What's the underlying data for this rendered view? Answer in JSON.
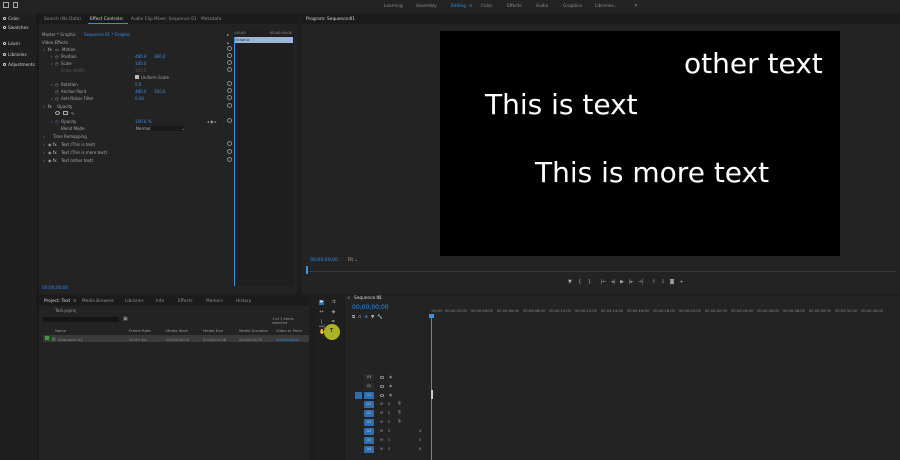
{
  "workspaces": [
    "Learning",
    "Assembly",
    "Editing",
    "Color",
    "Effects",
    "Audio",
    "Graphics",
    "Libraries..."
  ],
  "more_workspaces": "»",
  "left_nav": [
    "Color",
    "Swatches",
    "Learn",
    "Libraries",
    "Adjustments"
  ],
  "source_tabs": [
    "Search (No Data)",
    "Effect Controls",
    "Audio Clip Mixer: Sequence 01",
    "Metadata"
  ],
  "ec": {
    "master": "Master * Graphic",
    "sequence": "Sequence 01 * Graphic",
    "ruler_start": ";00;00",
    "ruler_end": "00;00;04;00",
    "clip": "Graphic",
    "video_effects": "Video Effects",
    "motion": "Motion",
    "position": "Position",
    "position_x": "480.0",
    "position_y": "360.0",
    "scale": "Scale",
    "scale_v": "100.0",
    "scale_width": "Scale Width",
    "scale_width_v": "100.0",
    "uniform": "Uniform Scale",
    "rotation": "Rotation",
    "rotation_v": "0.0",
    "anchor": "Anchor Point",
    "anchor_x": "480.0",
    "anchor_y": "360.0",
    "anti_flicker": "Anti-flicker Filter",
    "anti_flicker_v": "0.00",
    "opacity": "Opacity",
    "opacity_prop": "Opacity",
    "opacity_v": "100.0 %",
    "blend": "Blend Mode",
    "blend_v": "Normal",
    "time_remap": "Time Remapping",
    "text1": "Text (This is text)",
    "text2": "Text (This is more text)",
    "text3": "Text (other text)",
    "timecode": "00;00;00;00"
  },
  "program": {
    "title": "Program: Sequence 01",
    "text_other": "other text",
    "text_main": "This is text",
    "text_more": "This is more text",
    "timecode": "00;00;00;00",
    "fit": "Fit"
  },
  "project_tabs": [
    "Project: Text",
    "Media Browser",
    "Libraries",
    "Info",
    "Effects",
    "Markers",
    "History"
  ],
  "project": {
    "file": "Text.prproj",
    "items_selected": "1 of 1 items selected",
    "columns": [
      "Name",
      "Frame Rate",
      "Media Start",
      "Media End",
      "Media Duration",
      "Video In Point"
    ],
    "row": [
      "Sequence 01",
      "29.97 fps",
      "00;00;00;00",
      "00;00;04;28",
      "00;00;04;29",
      "00;00;00;00"
    ]
  },
  "timeline": {
    "title": "Sequence 01",
    "timecode": "00;00;00;00",
    "ruler": [
      ":00;00",
      "00;00;02;00",
      "00;00;04;00",
      "00;00;06;00",
      "00;00;08;00",
      "00;00;10;00",
      "00;00;12;00",
      "00;00;14;00",
      "00;00;16;00",
      "00;00;18;00",
      "00;00;20;00",
      "00;00;22;00",
      "00;00;24;00",
      "00;00;26;00",
      "00;00;28;00",
      "00;00;30;00",
      "00;00;32;00",
      "00;00;34;00",
      "00;00;36;00",
      "00;00;38;00",
      "00;00;40;00",
      "00;00;42;00",
      "00;00;44;00",
      "00;00;46;00"
    ],
    "tracks": [
      "V3",
      "V2",
      "V1",
      "A1",
      "A2",
      "A3",
      "A4",
      "A5",
      "A6"
    ],
    "audio_nums": [
      "1",
      "2",
      "3",
      "4",
      "5",
      "6"
    ]
  }
}
